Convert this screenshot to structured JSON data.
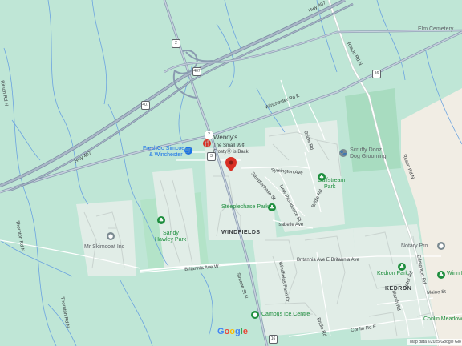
{
  "map": {
    "google_logo": [
      "G",
      "o",
      "o",
      "g",
      "l",
      "e"
    ],
    "attribution": "Map data ©2025 Google   Glo",
    "colors": {
      "land": "#bfe6d6",
      "park": "#a8dcc0",
      "farm": "#f1ede4",
      "highway": "#8a9bb0",
      "road": "#ffffff",
      "water": "#6ba3e0",
      "urban": "#e3ebe8"
    }
  },
  "streets": {
    "hwy407_north": "Hwy 407",
    "hwy407_south": "Hwy 407",
    "ritson_north": "Ritson Rd N",
    "ritson_south": "Ritson Rd N",
    "winchester": "Winchester Rd E",
    "simcoe_n": "Simcoe St N",
    "thornton_1": "Thornton Rd N",
    "thornton_2": "Thornton Rd N",
    "steeplechase": "Steeplechase St",
    "symington": "Symington Ave",
    "new_providence": "New Providence St",
    "bridle_1": "Bridle Rd",
    "bridle_2": "Bridle Rd",
    "bridle_3": "Bridle Rd",
    "isabelle": "Isabelle Ave",
    "britannia_w": "Britannia Ave W",
    "britannia_e": "Britannia Ave E Britannia Ave",
    "conlin": "Conlin Rd E",
    "maine": "Maine St",
    "kedron_dells": "Kedron Dells",
    "ritson_left": "Ritson Rd N",
    "windfields_farm": "Windfields Farm Dr",
    "marsh": "Marsh Rd",
    "peter": "Peter Rd",
    "edmonton": "Edmonton Rd"
  },
  "shields": {
    "s_407": "407",
    "s_2": "2",
    "s_3": "3",
    "s_2b": "2",
    "s_16": "16",
    "s_16b": "16",
    "s_407b": "407"
  },
  "pois": {
    "elm": "Elm Cemetery",
    "wendys": "Wendy's",
    "wendys_sub1": "The Small 99¢",
    "wendys_sub2": "FrostyⓇ is Back",
    "freshco_1": "FreshCo Simcoe",
    "freshco_2": "& Winchester",
    "scruffy_1": "Scruffy Dooz",
    "scruffy_2": "Dog Grooming",
    "gulfstream_1": "Gulfstream",
    "gulfstream_2": "Park",
    "steeplechase_park": "Steeplechase Park",
    "sandy_1": "Sandy",
    "sandy_2": "Hawley Park",
    "skimcoat": "Mr Skimcoat Inc",
    "notary": "Notary Pro",
    "kedron_park": "Kedron Park",
    "winn": "Winn F",
    "campus": "Campus Ice Centre",
    "conlin_meadows": "Conlin Meadows"
  },
  "areas": {
    "windfields": "WINDFIELDS",
    "kedron": "KEDRON"
  }
}
